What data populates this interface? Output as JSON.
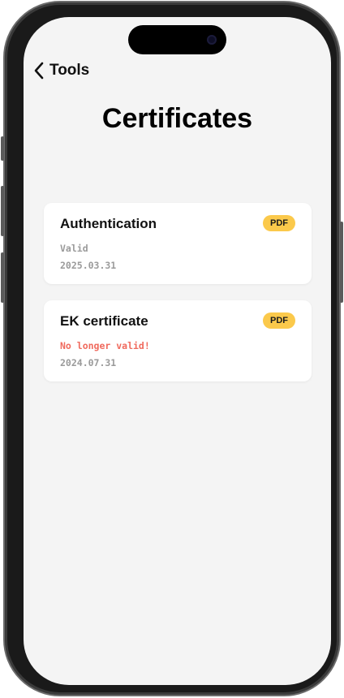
{
  "nav": {
    "back_label": "Tools"
  },
  "page": {
    "title": "Certificates"
  },
  "certificates": [
    {
      "name": "Authentication",
      "badge": "PDF",
      "status": "Valid",
      "date": "2025.03.31"
    },
    {
      "name": "EK certificate",
      "badge": "PDF",
      "status": "No longer valid!",
      "date": "2024.07.31"
    }
  ],
  "colors": {
    "background": "#f4f4f4",
    "card": "#ffffff",
    "badge": "#fbc94b",
    "status_valid": "#9a9a9a",
    "status_invalid": "#f06a5d"
  },
  "icons": {
    "back": "chevron-left-icon",
    "camera": "front-camera-icon"
  }
}
